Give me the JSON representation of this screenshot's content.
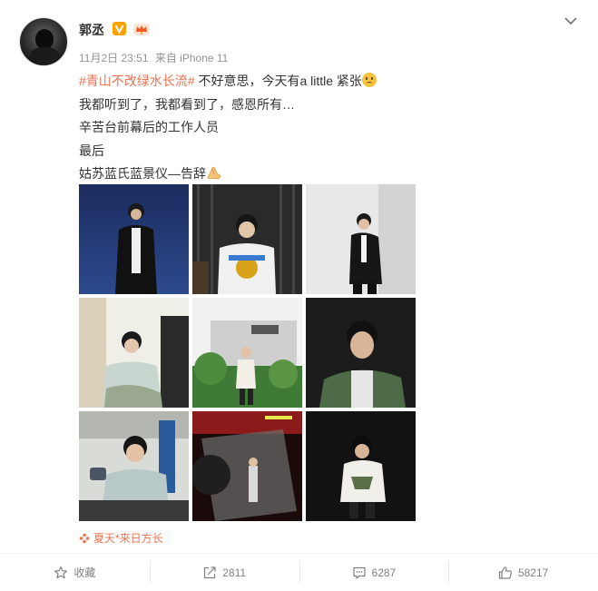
{
  "post": {
    "author": "郭丞",
    "time": "11月2日 23:51",
    "source": "来自 iPhone 11",
    "lines": {
      "line1_hashtag": "#青山不改绿水长流#",
      "line1_text": " 不好意思，今天有a little 紧张",
      "line2": "我都听到了，我都看到了，感恩所有…",
      "line3": "辛苦台前幕后的工作人员",
      "line4": "最后",
      "line5": "姑苏蓝氏蓝景仪—告辞"
    },
    "location": "夏天*来日方长"
  },
  "actions": {
    "favorite_label": "收藏",
    "repost_count": "2811",
    "comment_count": "6287",
    "like_count": "58217"
  },
  "icons": {
    "verified": "verified-v-icon",
    "vip": "vip-crown-icon",
    "menu": "chevron-down-icon",
    "favorite": "star-icon",
    "repost": "share-icon",
    "comment": "comment-icon",
    "like": "thumbs-up-icon",
    "location": "location-flower-icon"
  },
  "colors": {
    "hashtag": "#eb7350",
    "meta_text": "#939393",
    "action_text": "#808080",
    "verified_badge": "#ffa200"
  }
}
